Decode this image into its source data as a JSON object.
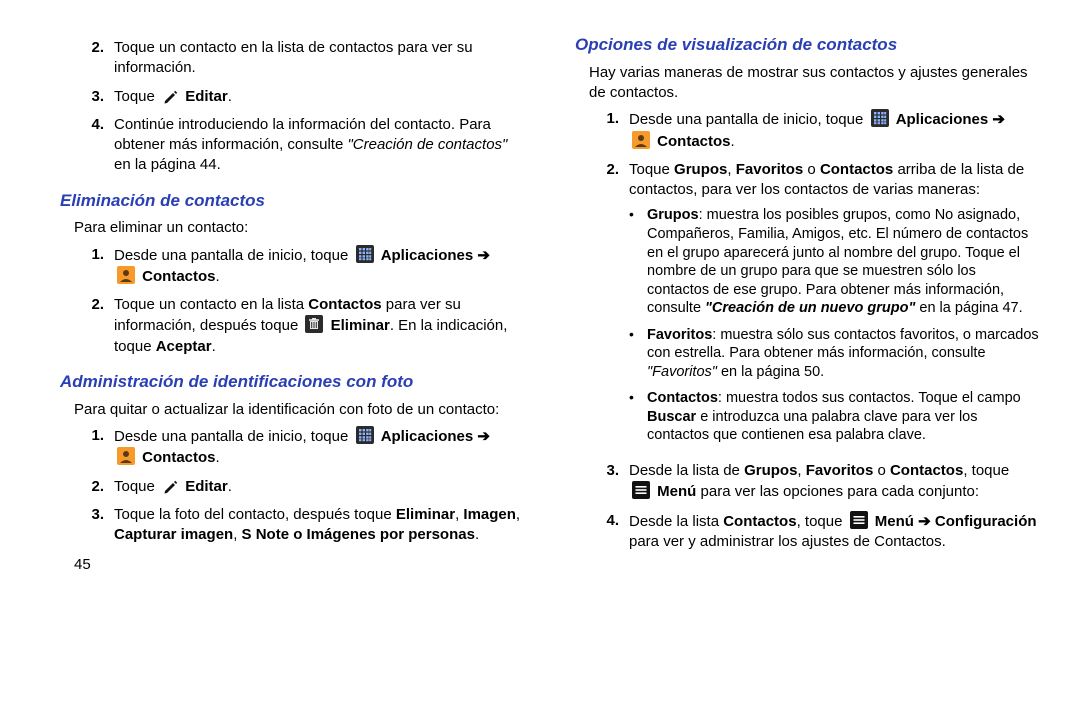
{
  "left": {
    "step2": "Toque un contacto en la lista de contactos para ver su información.",
    "step3_pre": "Toque ",
    "step3_editar": "Editar",
    "step3_post": ".",
    "step4_a": "Continúe introduciendo la información del contacto. Para obtener más información, consulte ",
    "step4_ref": "\"Creación de contactos\"",
    "step4_b": " en la página 44.",
    "h_elim": "Eliminación de contactos",
    "elim_intro": "Para eliminar un contacto:",
    "elim1_a": "Desde una pantalla de inicio, toque ",
    "elim1_apps": "Aplicaciones",
    "elim1_arrow": " ➔ ",
    "elim1_contactos": "Contactos",
    "elim1_end": ".",
    "elim2_a": "Toque un contacto en la lista ",
    "elim2_b": "Contactos",
    "elim2_c": " para ver su información, después toque ",
    "elim2_d": "Eliminar",
    "elim2_e": ". En la indicación, toque ",
    "elim2_f": "Aceptar",
    "elim2_g": ".",
    "h_admin": "Administración de identificaciones con foto",
    "admin_intro": "Para quitar o actualizar la identificación con foto de un contacto:",
    "admin1_a": "Desde una pantalla de inicio, toque ",
    "admin1_apps": "Aplicaciones",
    "admin1_arrow": " ➔ ",
    "admin1_contactos": "Contactos",
    "admin1_end": ".",
    "admin2_pre": "Toque ",
    "admin2_editar": "Editar",
    "admin2_post": ".",
    "admin3_a": "Toque la foto del contacto, después toque ",
    "admin3_b": "Eliminar",
    "admin3_c": ", ",
    "admin3_d": "Imagen",
    "admin3_e": ", ",
    "admin3_f": "Capturar imagen",
    "admin3_g": ", ",
    "admin3_h": "S Note o Imágenes por personas",
    "admin3_i": ".",
    "pagenum": "45"
  },
  "right": {
    "h_opt": "Opciones de visualización de contactos",
    "opt_intro": "Hay varias maneras de mostrar sus contactos y ajustes generales de contactos.",
    "opt1_a": "Desde una pantalla de inicio, toque ",
    "opt1_apps": "Aplicaciones",
    "opt1_arrow": " ➔ ",
    "opt1_contactos": "Contactos",
    "opt1_end": ".",
    "opt2_a": "Toque ",
    "opt2_b": "Grupos",
    "opt2_c": ", ",
    "opt2_d": "Favoritos",
    "opt2_e": " o ",
    "opt2_f": "Contactos",
    "opt2_g": " arriba de la lista de contactos, para ver los contactos de varias maneras:",
    "b1_a": "Grupos",
    "b1_b": ": muestra los posibles grupos, como No asignado, Compañeros, Familia, Amigos, etc. El número de contactos en el grupo aparecerá junto al nombre del grupo. Toque el nombre de un grupo para que se muestren sólo los contactos de ese grupo. Para obtener más información, consulte ",
    "b1_ref": "\"Creación de un nuevo grupo\"",
    "b1_c": " en la página 47.",
    "b2_a": "Favoritos",
    "b2_b": ": muestra sólo sus contactos favoritos, o marcados con estrella. Para obtener más información, consulte ",
    "b2_ref": "\"Favoritos\"",
    "b2_c": " en la página 50.",
    "b3_a": "Contactos",
    "b3_b": ": muestra todos sus contactos. Toque el campo ",
    "b3_c": "Buscar",
    "b3_d": " e introduzca una palabra clave para ver los contactos que contienen esa palabra clave.",
    "opt3_a": "Desde la lista de ",
    "opt3_b": "Grupos",
    "opt3_c": ", ",
    "opt3_d": "Favoritos",
    "opt3_e": " o ",
    "opt3_f": "Contactos",
    "opt3_g": ", toque ",
    "opt3_menu": "Menú",
    "opt3_h": " para ver las opciones para cada conjunto:",
    "opt4_a": "Desde la lista ",
    "opt4_b": "Contactos",
    "opt4_c": ", toque ",
    "opt4_menu": "Menú",
    "opt4_arrow": " ➔ ",
    "opt4_d": "Configuración",
    "opt4_e": " para ver y administrar los ajustes de Contactos."
  },
  "nums": {
    "n1": "1.",
    "n2": "2.",
    "n3": "3.",
    "n4": "4."
  }
}
